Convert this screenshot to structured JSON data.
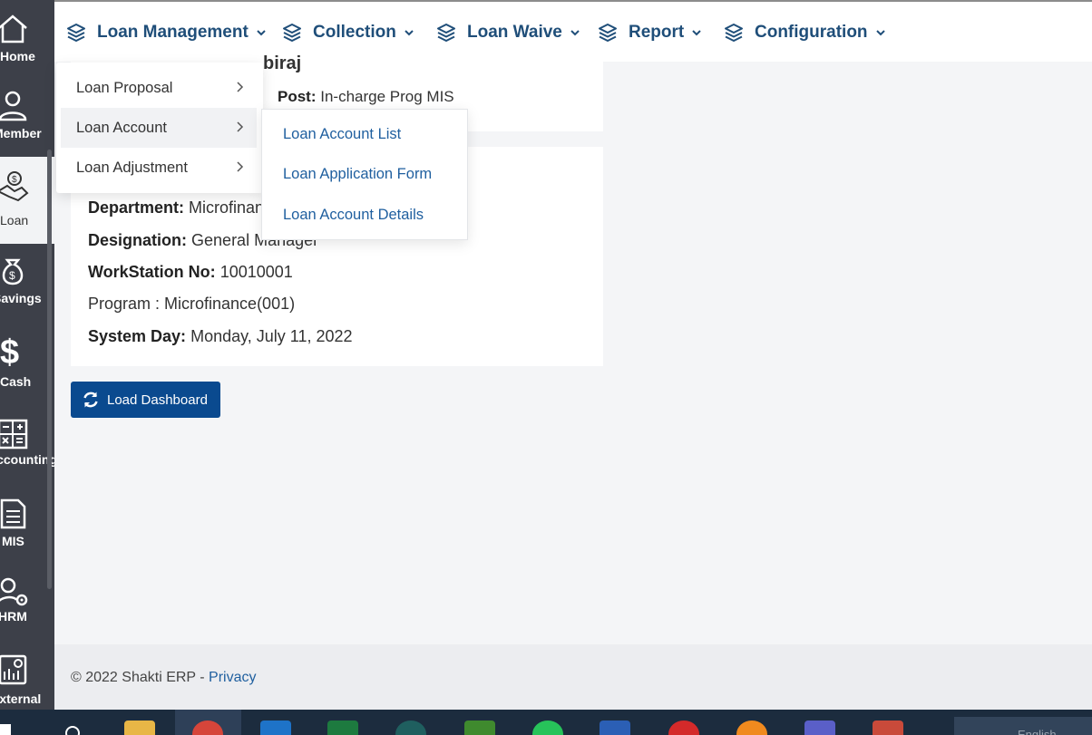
{
  "sidebar": {
    "items": [
      {
        "label": "Home",
        "icon": "home-icon"
      },
      {
        "label": "Member",
        "icon": "user-icon"
      },
      {
        "label": "Loan",
        "icon": "loan-handshake-icon"
      },
      {
        "label": "Savings",
        "icon": "money-bag-icon"
      },
      {
        "label": "Cash",
        "icon": "dollar-icon"
      },
      {
        "label": "Accounting",
        "icon": "calculator-icon"
      },
      {
        "label": "MIS",
        "icon": "report-icon"
      },
      {
        "label": "HRM",
        "icon": "user-gear-icon"
      },
      {
        "label": "External",
        "icon": "external-report-icon"
      }
    ]
  },
  "nav": {
    "items": [
      {
        "label": "Loan Management"
      },
      {
        "label": "Collection"
      },
      {
        "label": "Loan Waive"
      },
      {
        "label": "Report"
      },
      {
        "label": "Configuration"
      }
    ]
  },
  "menu": {
    "loan_management": [
      "Loan Proposal",
      "Loan Account",
      "Loan Adjustment"
    ],
    "loan_account": [
      "Loan Account List",
      "Loan Application Form",
      "Loan Account Details"
    ]
  },
  "profile": {
    "name": "biraj",
    "post_label": "Post:",
    "post": "In-charge Prog MIS"
  },
  "info": {
    "department_label": "Department:",
    "department": "Microfinance",
    "designation_label": "Designation:",
    "designation": "General Manager",
    "workstation_label": "WorkStation No:",
    "workstation": "10010001",
    "program": "Program : Microfinance(001)",
    "system_day_label": "System Day:",
    "system_day": "Monday, July 11, 2022"
  },
  "actions": {
    "load_dashboard": "Load Dashboard"
  },
  "footer": {
    "copyright": "© 2022 Shakti ERP - ",
    "privacy": "Privacy"
  },
  "taskbar": {
    "language": "English"
  },
  "colors": {
    "primary": "#0a4a8f",
    "nav_text": "#1f4e79",
    "link": "#1f5f9f",
    "sidebar": "#3d4049"
  }
}
